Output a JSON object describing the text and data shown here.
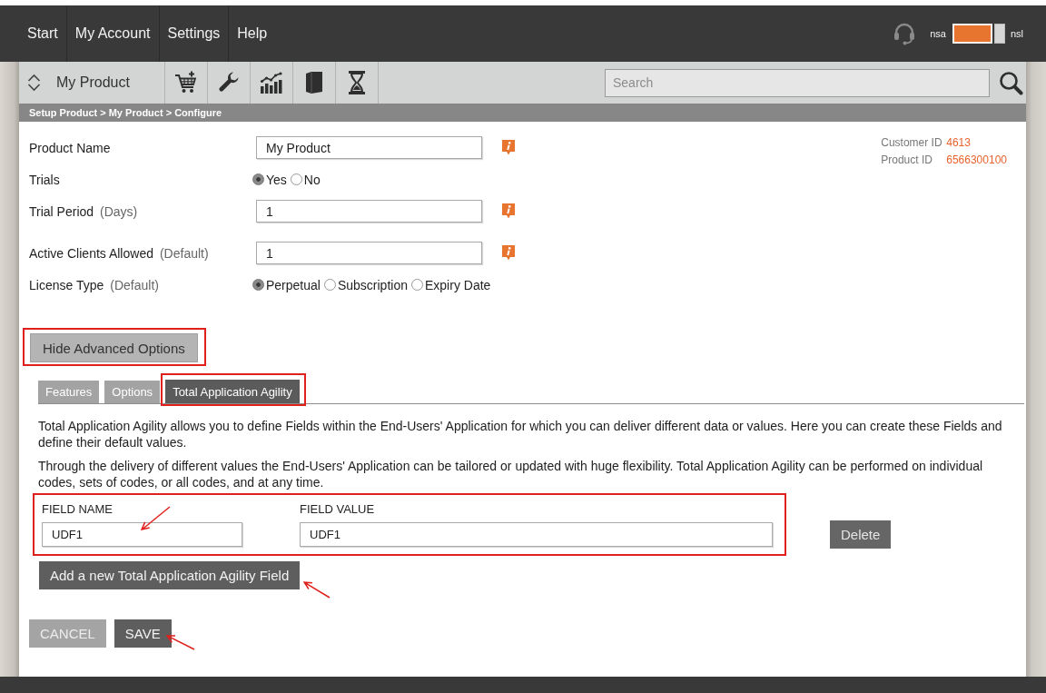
{
  "header": {
    "nav": [
      {
        "label": "Start"
      },
      {
        "label": "My Account"
      },
      {
        "label": "Settings"
      },
      {
        "label": "Help"
      }
    ],
    "toggle": {
      "left_label": "nsa",
      "right_label": "nsl",
      "on": true
    }
  },
  "toolbar": {
    "product": "My Product",
    "search": {
      "placeholder": "Search"
    }
  },
  "breadcrumb": "Setup Product > My Product > Configure",
  "form": {
    "rows": [
      {
        "kind": "text",
        "label": "Product Name",
        "value": "My Product",
        "info": true
      },
      {
        "kind": "radio",
        "label": "Trials",
        "options": [
          {
            "label": "Yes",
            "selected": true
          },
          {
            "label": "No",
            "selected": false
          }
        ]
      },
      {
        "kind": "text",
        "label": "Trial Period",
        "hint": "(Days)",
        "value": "1",
        "info": true
      },
      {
        "kind": "text",
        "label": "Active Clients Allowed",
        "hint": "(Default)",
        "value": "1",
        "info": true
      },
      {
        "kind": "radio",
        "label": "License Type",
        "hint": "(Default)",
        "options": [
          {
            "label": "Perpetual",
            "selected": true
          },
          {
            "label": "Subscription",
            "selected": false
          },
          {
            "label": "Expiry Date",
            "selected": false
          }
        ]
      }
    ]
  },
  "ids": [
    {
      "label": "Customer ID",
      "value": "4613"
    },
    {
      "label": "Product ID",
      "value": "6566300100"
    }
  ],
  "advanced_toggle": {
    "label": "Hide Advanced Options",
    "highlighted": true
  },
  "tabs": [
    {
      "label": "Features",
      "selected": false,
      "highlighted": false
    },
    {
      "label": "Options",
      "selected": false,
      "highlighted": false
    },
    {
      "label": "Total Application Agility",
      "selected": true,
      "highlighted": true
    }
  ],
  "description": [
    "Total Application Agility allows you to define Fields within the End-Users' Application for which you can deliver different data or values. Here you can create these Fields and define their default values.",
    "Through the delivery of different values the End-Users' Application can be tailored or updated with huge flexibility. Total Application Agility can be performed on individual codes, sets of codes, or all codes, and at any time."
  ],
  "custom_fields": {
    "highlighted": true,
    "columns": [
      "FIELD NAME",
      "FIELD VALUE"
    ],
    "rows": [
      {
        "name": "UDF1",
        "value": "UDF1",
        "name_arrow": true,
        "delete_label": "Delete"
      }
    ]
  },
  "add_button": {
    "label": "Add a new Total Application Agility Field",
    "arrow": true
  },
  "actions": [
    {
      "label": "CANCEL",
      "kind": "secondary",
      "arrow": false
    },
    {
      "label": "SAVE",
      "kind": "primary",
      "arrow": true
    }
  ]
}
